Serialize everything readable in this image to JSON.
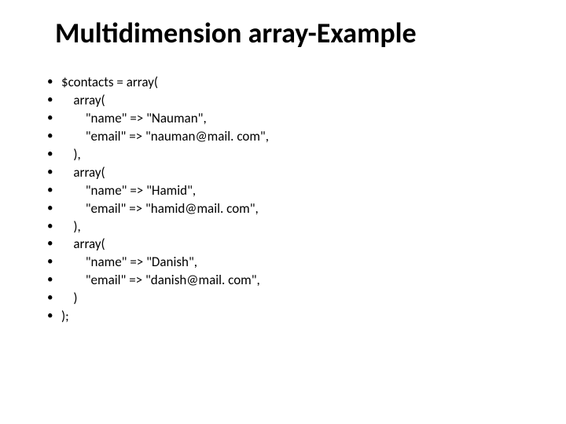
{
  "title": "Multidimension array-Example",
  "lines": [
    "$contacts = array(",
    "    array(",
    "        \"name\" => \"Nauman\",",
    "        \"email\" => \"nauman@mail. com\",",
    "    ),",
    "    array(",
    "        \"name\" => \"Hamid\",",
    "        \"email\" => \"hamid@mail. com\",",
    "    ),",
    "    array(",
    "        \"name\" => \"Danish\",",
    "        \"email\" => \"danish@mail. com\",",
    "    )",
    ");"
  ]
}
